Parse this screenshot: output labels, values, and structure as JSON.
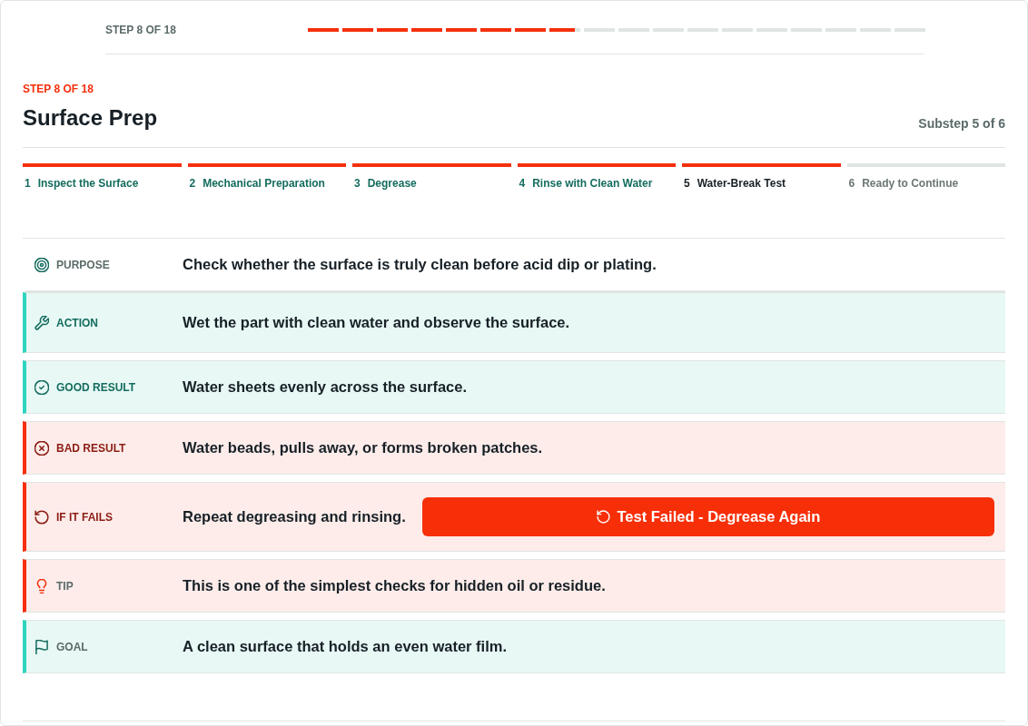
{
  "progress": {
    "label": "STEP 8 OF 18",
    "level": 0.433
  },
  "header": {
    "step_label": "STEP 8 OF 18",
    "title": "Surface Prep",
    "substep_counter": "Substep 5 of 6"
  },
  "substeps": [
    {
      "number": "1",
      "label": "Inspect the Surface",
      "done": true,
      "selected": false
    },
    {
      "number": "2",
      "label": "Mechanical Preparation",
      "done": true,
      "selected": false
    },
    {
      "number": "3",
      "label": "Degrease",
      "done": true,
      "selected": false
    },
    {
      "number": "4",
      "label": "Rinse with Clean Water",
      "done": true,
      "selected": false
    },
    {
      "number": "5",
      "label": "Water-Break Test",
      "done": true,
      "selected": true
    },
    {
      "number": "6",
      "label": "Ready to Continue",
      "done": false,
      "selected": false
    }
  ],
  "rows": [
    {
      "kind": "purpose",
      "label": "PURPOSE",
      "text": "Check whether the surface is truly clean before acid dip or plating."
    },
    {
      "kind": "action",
      "label": "ACTION",
      "text": "Wet the part with clean water and observe the surface."
    },
    {
      "kind": "good",
      "label": "GOOD RESULT",
      "text": "Water sheets evenly across the surface."
    },
    {
      "kind": "bad",
      "label": "BAD RESULT",
      "text": "Water beads, pulls away, or forms broken patches."
    },
    {
      "kind": "fails",
      "label": "IF IT FAILS",
      "text": "Repeat degreasing and rinsing.",
      "button": {
        "label": "Test Failed - Degrease Again"
      }
    },
    {
      "kind": "tip",
      "label": "TIP",
      "text": "This is one of the simplest checks for hidden oil or residue."
    },
    {
      "kind": "goal",
      "label": "GOAL",
      "text": "A clean surface that holds an even water film."
    }
  ]
}
